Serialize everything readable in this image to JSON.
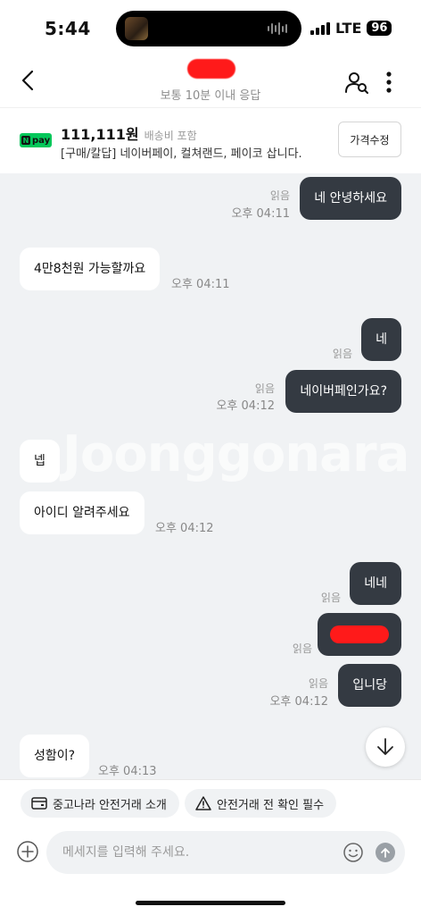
{
  "status_bar": {
    "time": "5:44",
    "network": "LTE",
    "battery": "96"
  },
  "header": {
    "subtitle": "보통 10분 이내 응답",
    "back_icon": "chevron-left-icon",
    "user_icon": "user-search-icon",
    "more_icon": "more-vertical-icon"
  },
  "product": {
    "pay_badge": "pay",
    "price": "111,111원",
    "shipping": "배송비 포함",
    "methods": "[구매/칼답] 네이버페이, 컬쳐랜드, 페이코 삽니다.",
    "edit_price_label": "가격수정"
  },
  "watermark": "Joonggonara",
  "messages": [
    {
      "side": "mine",
      "text": "네 안녕하세요",
      "read": "읽음",
      "time": "오후 04:11"
    },
    {
      "side": "theirs",
      "text": "4만8천원 가능할까요",
      "time": "오후 04:11"
    },
    {
      "side": "mine",
      "text": "네",
      "read": "읽음"
    },
    {
      "side": "mine",
      "text": "네이버페인가요?",
      "read": "읽음",
      "time": "오후 04:12"
    },
    {
      "side": "theirs",
      "text": "넵"
    },
    {
      "side": "theirs",
      "text": "아이디 알려주세요",
      "time": "오후 04:12"
    },
    {
      "side": "mine",
      "text": "네네",
      "read": "읽음"
    },
    {
      "side": "mine",
      "text": "",
      "read": "읽음",
      "redacted": true
    },
    {
      "side": "mine",
      "text": "입니당",
      "read": "읽음",
      "time": "오후 04:12"
    },
    {
      "side": "theirs",
      "text": "성함이?",
      "time": "오후 04:13"
    }
  ],
  "chips": {
    "guide": "중고나라 안전거래 소개",
    "warning": "안전거래 전 확인 필수"
  },
  "composer": {
    "placeholder": "메세지를 입력해 주세요."
  },
  "colors": {
    "mine_bubble": "#343a42",
    "chat_bg": "#f0f2f4",
    "npay_green": "#03c75a"
  }
}
